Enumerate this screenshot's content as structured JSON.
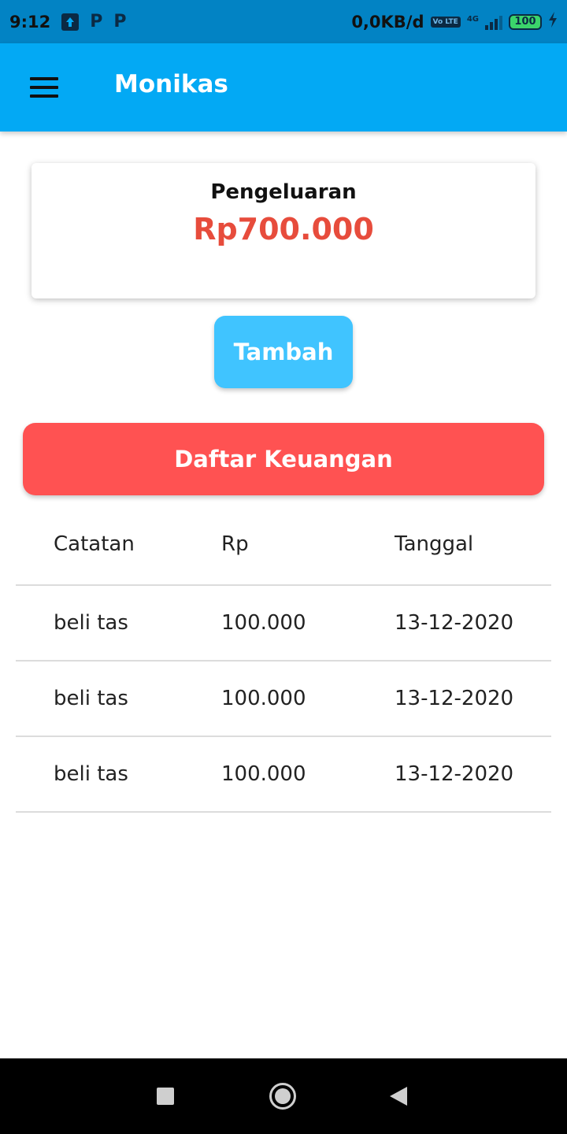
{
  "status_bar": {
    "time": "9:12",
    "p_icon_1": "P",
    "p_icon_2": "P",
    "data_speed": "0,0KB/d",
    "volte": "Vo LTE",
    "network": "4G",
    "battery": "100"
  },
  "app_bar": {
    "title": "Monikas"
  },
  "summary": {
    "label": "Pengeluaran",
    "amount": "Rp700.000",
    "amount_color": "#E74C3C"
  },
  "add_button": {
    "label": "Tambah",
    "color": "#40C4FF"
  },
  "section": {
    "title": "Daftar Keuangan",
    "color": "#FF5252"
  },
  "table": {
    "headers": [
      "Catatan",
      "Rp",
      "Tanggal"
    ],
    "rows": [
      [
        "beli tas",
        "100.000",
        "13-12-2020"
      ],
      [
        "beli tas",
        "100.000",
        "13-12-2020"
      ],
      [
        "beli tas",
        "100.000",
        "13-12-2020"
      ]
    ]
  },
  "colors": {
    "status_bar": "#0283C4",
    "app_bar": "#03A9F4"
  }
}
